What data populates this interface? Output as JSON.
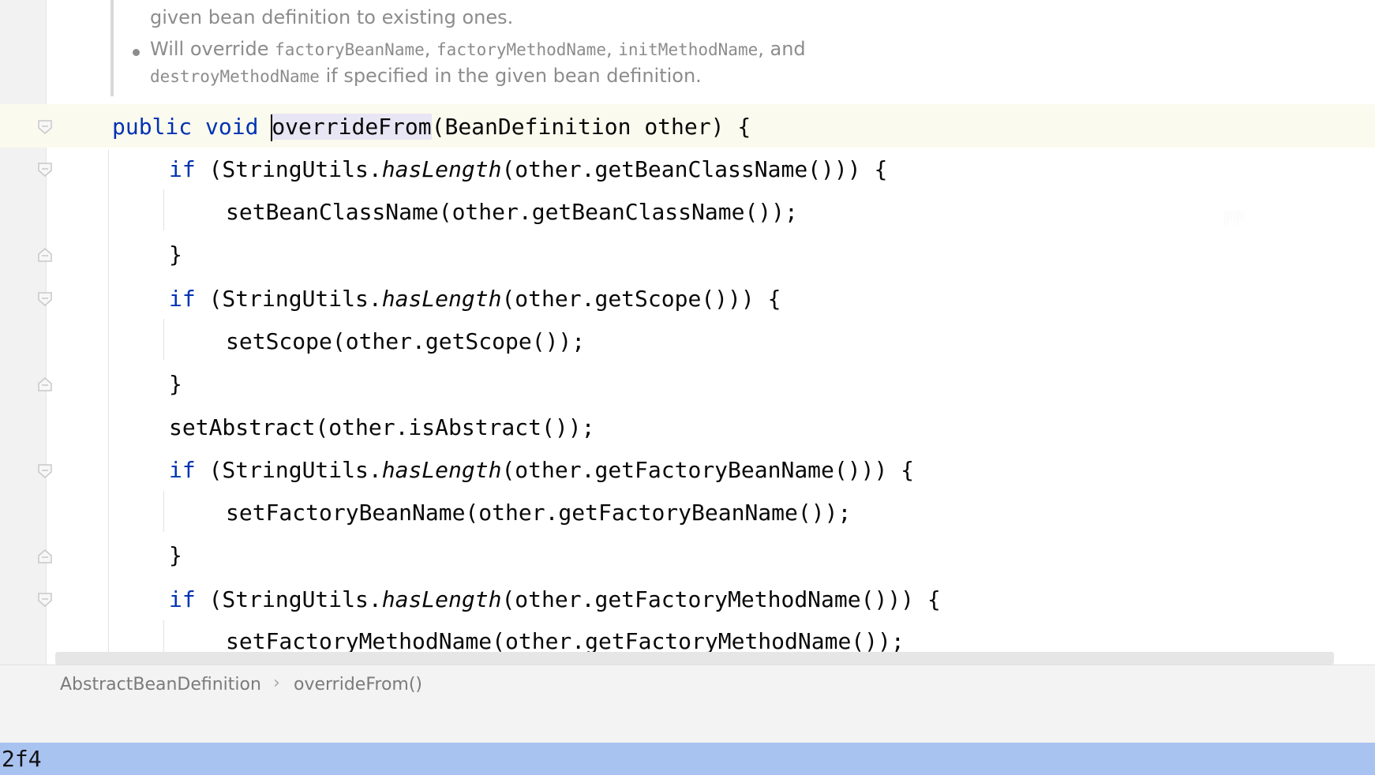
{
  "doc_comment": {
    "line1": "given bean definition to existing ones.",
    "line2_prefix": "Will override ",
    "line2_code1": "factoryBeanName",
    "line2_sep1": ", ",
    "line2_code2": "factoryMethodName",
    "line2_sep2": ", ",
    "line2_code3": "initMethodName",
    "line2_suffix": ", and",
    "line3_code": "destroyMethodName",
    "line3_suffix": " if specified in the given bean definition."
  },
  "code": {
    "l1_kw1": "public",
    "l1_kw2": "void",
    "l1_method": "overrideFrom",
    "l1_rest": "(BeanDefinition other) {",
    "l2_kw": "if",
    "l2_a": " (StringUtils.",
    "l2_it": "hasLength",
    "l2_b": "(other.getBeanClassName())) {",
    "l3": "setBeanClassName(other.getBeanClassName());",
    "l4": "}",
    "l5_kw": "if",
    "l5_a": " (StringUtils.",
    "l5_it": "hasLength",
    "l5_b": "(other.getScope())) {",
    "l6": "setScope(other.getScope());",
    "l7": "}",
    "l8": "setAbstract(other.isAbstract());",
    "l9_kw": "if",
    "l9_a": " (StringUtils.",
    "l9_it": "hasLength",
    "l9_b": "(other.getFactoryBeanName())) {",
    "l10": "setFactoryBeanName(other.getFactoryBeanName());",
    "l11": "}",
    "l12_kw": "if",
    "l12_a": " (StringUtils.",
    "l12_it": "hasLength",
    "l12_b": "(other.getFactoryMethodName())) {",
    "l13": "setFactoryMethodName(other.getFactoryMethodName());"
  },
  "overlay_text": "PP",
  "breadcrumb": {
    "class_name": "AbstractBeanDefinition",
    "separator": "›",
    "method_name": "overrideFrom()"
  },
  "status": {
    "text": "2f4"
  },
  "colors": {
    "keyword": "#0033b3",
    "status_bar": "#a9c3f0",
    "caret_line": "#fbfaee",
    "method_highlight": "#e8e6f4"
  }
}
